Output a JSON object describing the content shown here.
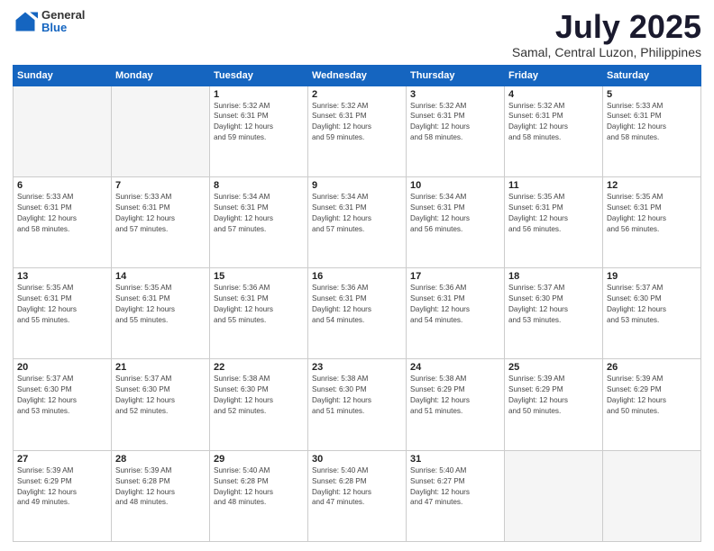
{
  "header": {
    "logo_general": "General",
    "logo_blue": "Blue",
    "title": "July 2025",
    "location": "Samal, Central Luzon, Philippines"
  },
  "calendar": {
    "days_of_week": [
      "Sunday",
      "Monday",
      "Tuesday",
      "Wednesday",
      "Thursday",
      "Friday",
      "Saturday"
    ],
    "weeks": [
      [
        {
          "day": "",
          "info": ""
        },
        {
          "day": "",
          "info": ""
        },
        {
          "day": "1",
          "info": "Sunrise: 5:32 AM\nSunset: 6:31 PM\nDaylight: 12 hours\nand 59 minutes."
        },
        {
          "day": "2",
          "info": "Sunrise: 5:32 AM\nSunset: 6:31 PM\nDaylight: 12 hours\nand 59 minutes."
        },
        {
          "day": "3",
          "info": "Sunrise: 5:32 AM\nSunset: 6:31 PM\nDaylight: 12 hours\nand 58 minutes."
        },
        {
          "day": "4",
          "info": "Sunrise: 5:32 AM\nSunset: 6:31 PM\nDaylight: 12 hours\nand 58 minutes."
        },
        {
          "day": "5",
          "info": "Sunrise: 5:33 AM\nSunset: 6:31 PM\nDaylight: 12 hours\nand 58 minutes."
        }
      ],
      [
        {
          "day": "6",
          "info": "Sunrise: 5:33 AM\nSunset: 6:31 PM\nDaylight: 12 hours\nand 58 minutes."
        },
        {
          "day": "7",
          "info": "Sunrise: 5:33 AM\nSunset: 6:31 PM\nDaylight: 12 hours\nand 57 minutes."
        },
        {
          "day": "8",
          "info": "Sunrise: 5:34 AM\nSunset: 6:31 PM\nDaylight: 12 hours\nand 57 minutes."
        },
        {
          "day": "9",
          "info": "Sunrise: 5:34 AM\nSunset: 6:31 PM\nDaylight: 12 hours\nand 57 minutes."
        },
        {
          "day": "10",
          "info": "Sunrise: 5:34 AM\nSunset: 6:31 PM\nDaylight: 12 hours\nand 56 minutes."
        },
        {
          "day": "11",
          "info": "Sunrise: 5:35 AM\nSunset: 6:31 PM\nDaylight: 12 hours\nand 56 minutes."
        },
        {
          "day": "12",
          "info": "Sunrise: 5:35 AM\nSunset: 6:31 PM\nDaylight: 12 hours\nand 56 minutes."
        }
      ],
      [
        {
          "day": "13",
          "info": "Sunrise: 5:35 AM\nSunset: 6:31 PM\nDaylight: 12 hours\nand 55 minutes."
        },
        {
          "day": "14",
          "info": "Sunrise: 5:35 AM\nSunset: 6:31 PM\nDaylight: 12 hours\nand 55 minutes."
        },
        {
          "day": "15",
          "info": "Sunrise: 5:36 AM\nSunset: 6:31 PM\nDaylight: 12 hours\nand 55 minutes."
        },
        {
          "day": "16",
          "info": "Sunrise: 5:36 AM\nSunset: 6:31 PM\nDaylight: 12 hours\nand 54 minutes."
        },
        {
          "day": "17",
          "info": "Sunrise: 5:36 AM\nSunset: 6:31 PM\nDaylight: 12 hours\nand 54 minutes."
        },
        {
          "day": "18",
          "info": "Sunrise: 5:37 AM\nSunset: 6:30 PM\nDaylight: 12 hours\nand 53 minutes."
        },
        {
          "day": "19",
          "info": "Sunrise: 5:37 AM\nSunset: 6:30 PM\nDaylight: 12 hours\nand 53 minutes."
        }
      ],
      [
        {
          "day": "20",
          "info": "Sunrise: 5:37 AM\nSunset: 6:30 PM\nDaylight: 12 hours\nand 53 minutes."
        },
        {
          "day": "21",
          "info": "Sunrise: 5:37 AM\nSunset: 6:30 PM\nDaylight: 12 hours\nand 52 minutes."
        },
        {
          "day": "22",
          "info": "Sunrise: 5:38 AM\nSunset: 6:30 PM\nDaylight: 12 hours\nand 52 minutes."
        },
        {
          "day": "23",
          "info": "Sunrise: 5:38 AM\nSunset: 6:30 PM\nDaylight: 12 hours\nand 51 minutes."
        },
        {
          "day": "24",
          "info": "Sunrise: 5:38 AM\nSunset: 6:29 PM\nDaylight: 12 hours\nand 51 minutes."
        },
        {
          "day": "25",
          "info": "Sunrise: 5:39 AM\nSunset: 6:29 PM\nDaylight: 12 hours\nand 50 minutes."
        },
        {
          "day": "26",
          "info": "Sunrise: 5:39 AM\nSunset: 6:29 PM\nDaylight: 12 hours\nand 50 minutes."
        }
      ],
      [
        {
          "day": "27",
          "info": "Sunrise: 5:39 AM\nSunset: 6:29 PM\nDaylight: 12 hours\nand 49 minutes."
        },
        {
          "day": "28",
          "info": "Sunrise: 5:39 AM\nSunset: 6:28 PM\nDaylight: 12 hours\nand 48 minutes."
        },
        {
          "day": "29",
          "info": "Sunrise: 5:40 AM\nSunset: 6:28 PM\nDaylight: 12 hours\nand 48 minutes."
        },
        {
          "day": "30",
          "info": "Sunrise: 5:40 AM\nSunset: 6:28 PM\nDaylight: 12 hours\nand 47 minutes."
        },
        {
          "day": "31",
          "info": "Sunrise: 5:40 AM\nSunset: 6:27 PM\nDaylight: 12 hours\nand 47 minutes."
        },
        {
          "day": "",
          "info": ""
        },
        {
          "day": "",
          "info": ""
        }
      ]
    ]
  }
}
